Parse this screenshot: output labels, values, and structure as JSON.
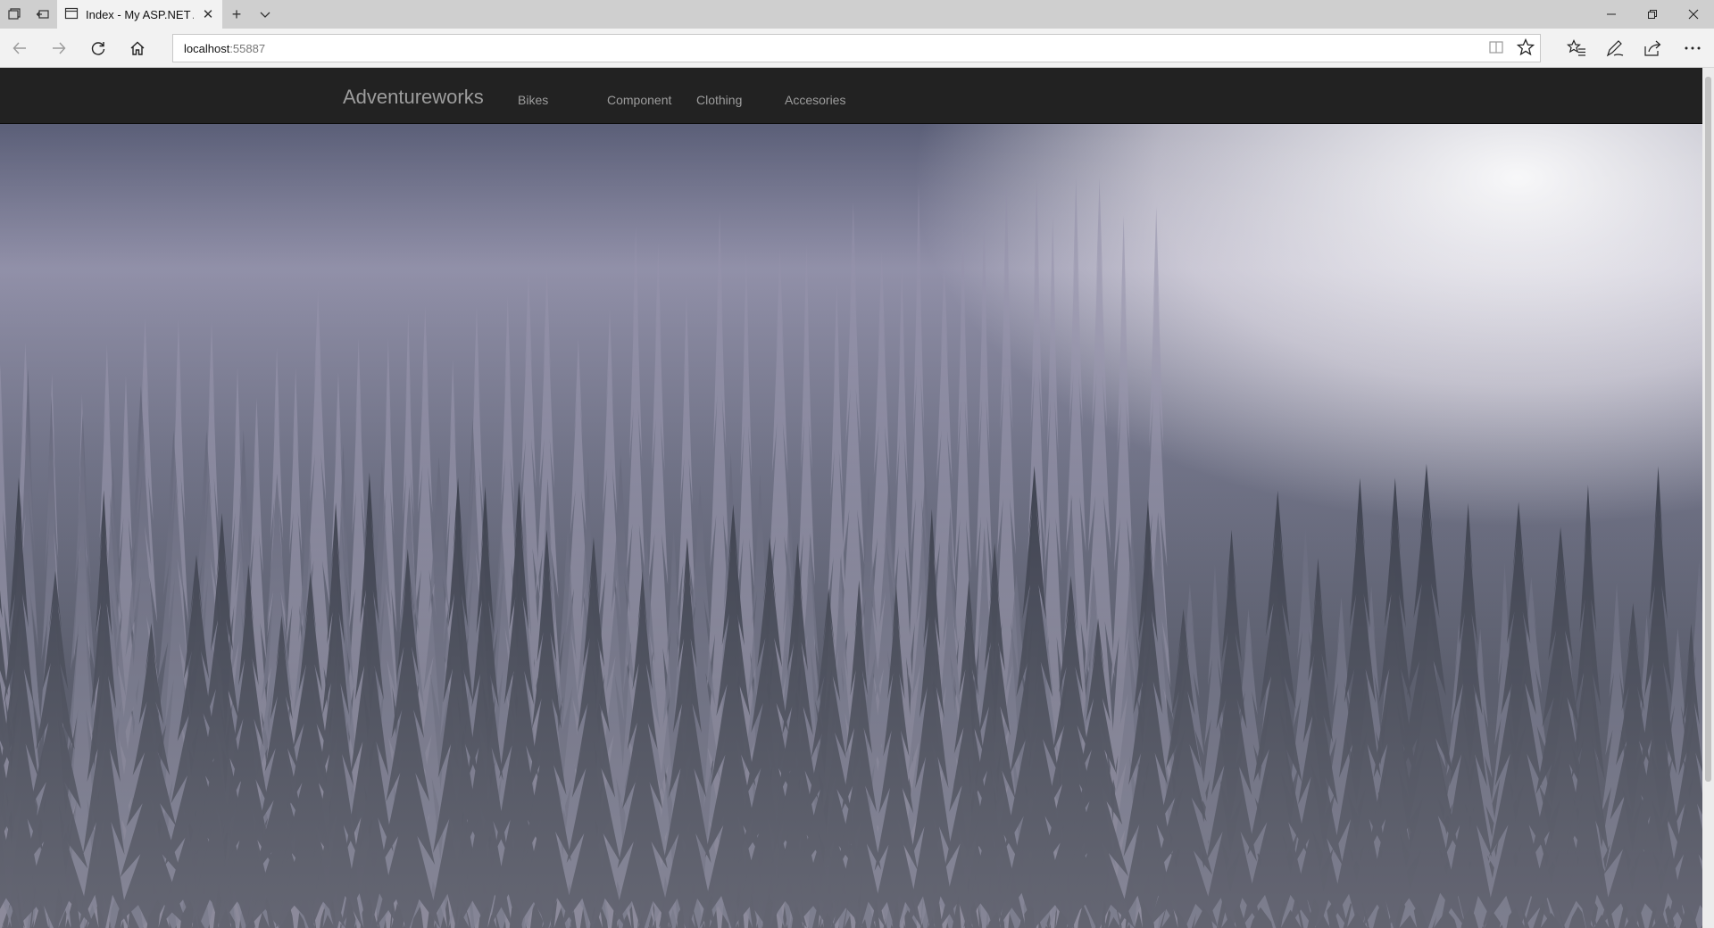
{
  "browser": {
    "tab_title": "Index - My ASP.NET Ap",
    "url_host": "localhost",
    "url_port": ":55887"
  },
  "icons": {
    "tab_manager": "tab-manager-icon",
    "set_aside": "set-aside-icon",
    "page": "page-icon",
    "close_tab": "close-icon",
    "new_tab": "plus-icon",
    "tab_list": "chevron-down-icon",
    "back": "back-arrow-icon",
    "forward": "forward-arrow-icon",
    "refresh": "refresh-icon",
    "home": "home-icon",
    "reading_view": "book-icon",
    "favorite": "star-icon",
    "favorites_hub": "favorites-list-icon",
    "notes": "pen-icon",
    "share": "share-icon",
    "more": "more-icon",
    "minimize": "minimize-icon",
    "restore": "restore-icon",
    "close_window": "close-icon"
  },
  "site": {
    "brand": "Adventureworks",
    "nav": [
      {
        "label": "Bikes"
      },
      {
        "label": "Component"
      },
      {
        "label": "Clothing"
      },
      {
        "label": "Accesories"
      }
    ]
  },
  "colors": {
    "navbar_bg": "#222222",
    "nav_text": "#9d9d9d",
    "chrome_bg": "#f2f2f2"
  }
}
